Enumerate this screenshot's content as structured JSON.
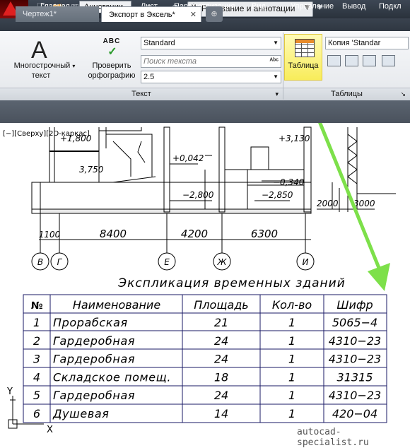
{
  "titlebar": {
    "workspace": "Рисование и аннотации",
    "qa_icons": [
      "new-icon",
      "open-icon",
      "save-icon",
      "saveas-icon",
      "print-icon",
      "undo-icon",
      "redo-icon",
      "share-icon"
    ]
  },
  "ribbon_tabs": [
    "Главная",
    "Аннотации",
    "Лист",
    "Параметризация",
    "Вид",
    "Управление",
    "Вывод",
    "Подкл"
  ],
  "active_tab": "Аннотации",
  "text_panel": {
    "mtext_label_1": "Многострочный",
    "mtext_label_2": "текст",
    "spell_icon_text": "ABC",
    "spell_label_1": "Проверить",
    "spell_label_2": "орфографию",
    "style_value": "Standard",
    "search_placeholder": "Поиск текста",
    "height_value": "2.5",
    "panel_title": "Текст"
  },
  "tables_panel": {
    "table_button": "Таблица",
    "style_value": "Копия 'Standar",
    "panel_title": "Таблицы"
  },
  "doc_tabs": [
    "Чертеж1*",
    "Экспорт в Эксель*"
  ],
  "active_doc": "Экспорт в Эксель*",
  "viewport_label": "[−][Сверху][2D-каркас]",
  "plan": {
    "elevations": [
      "+1,800",
      "+0,042",
      "+3,130",
      "3,750",
      "−2,800",
      "−2,850",
      "−0,340",
      "2000",
      "3000"
    ],
    "dimensions": [
      "1100",
      "8400",
      "4200",
      "6300"
    ],
    "axes": [
      "В",
      "Г",
      "Е",
      "Ж",
      "И"
    ]
  },
  "table": {
    "title": "Экспликация временных зданий",
    "headers": [
      "№",
      "Наименование",
      "Площадь",
      "Кол-во",
      "Шифр"
    ],
    "rows": [
      [
        "1",
        "Прорабская",
        "21",
        "1",
        "5065−4"
      ],
      [
        "2",
        "Гардеробная",
        "24",
        "1",
        "4310−23"
      ],
      [
        "3",
        "Гардеробная",
        "24",
        "1",
        "4310−23"
      ],
      [
        "4",
        "Складское помещ.",
        "18",
        "1",
        "31315"
      ],
      [
        "5",
        "Гардеробная",
        "24",
        "1",
        "4310−23"
      ],
      [
        "6",
        "Душевая",
        "14",
        "1",
        "420−04"
      ]
    ]
  },
  "ucs": {
    "x": "X",
    "y": "Y"
  },
  "watermark": "autocad-specialist.ru",
  "colors": {
    "accent_arrow": "#7de04a",
    "highlight": "#fff36a",
    "titlebar": "#2f3741"
  }
}
